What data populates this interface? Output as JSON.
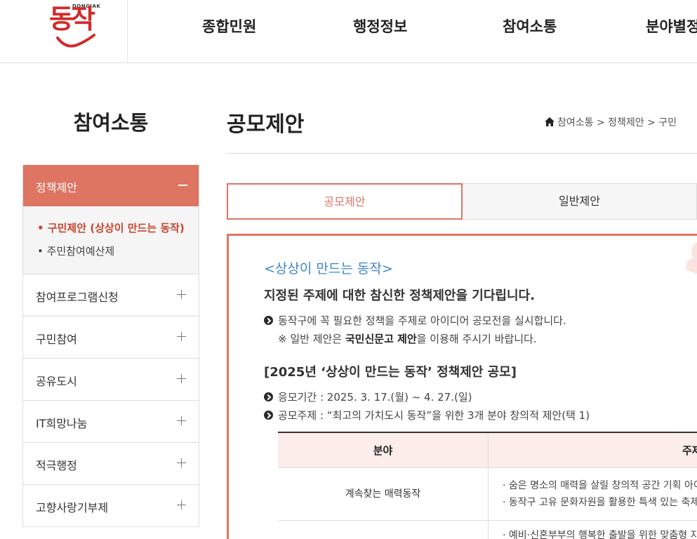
{
  "header": {
    "logo_small": "DONGJAK",
    "logo_main": "동작",
    "nav": [
      "종합민원",
      "행정정보",
      "참여소통",
      "분야별정"
    ]
  },
  "sidebar": {
    "title": "참여소통",
    "active": {
      "label": "정책제안"
    },
    "sub_items": [
      "구민제안 (상상이 만드는 동작)",
      "주민참여예산제"
    ],
    "items": [
      "참여프로그램신청",
      "구민참여",
      "공유도시",
      "IT희망나눔",
      "적극행정",
      "고향사랑기부제"
    ]
  },
  "content": {
    "title": "공모제안",
    "breadcrumb": "참여소통 > 정책제안 > 구민",
    "tabs": [
      "공모제안",
      "일반제안"
    ],
    "subtitle": "<상상이 만드는 동작>",
    "lead": "지정된 주제에 대한 참신한 정책제안을 기다립니다.",
    "bullet1": "동작구에 꼭 필요한 정책을 주제로 아이디어 공모전을 실시합니다.",
    "note_prefix": "※ 일반 제안은 ",
    "note_link": "국민신문고 제안",
    "note_suffix": "을 이용해 주시기 바랍니다.",
    "section_head": "[2025년 ‘상상이 만드는 동작’ 정책제안 공모]",
    "period": "응모기간 : 2025. 3. 17.(월) ~ 4. 27.(일)",
    "topic": "공모주제 : “최고의 가치도시 동작”을 위한 3개 분야 창의적 제안(택 1)",
    "table": {
      "headers": [
        "분야",
        "주제"
      ],
      "rows": [
        {
          "field": "계속찾는 매력동작",
          "lines": [
            "· 숨은 명소의 매력을 살릴 창의적 공간 기획 아이디어",
            "· 동작구 고유 문화자원을 활용한 특색 있는 축제"
          ]
        },
        {
          "field": "",
          "lines": [
            "· 예비·신혼부부의 행복한 출발을 위한 맞춤형 지원"
          ]
        }
      ]
    }
  }
}
